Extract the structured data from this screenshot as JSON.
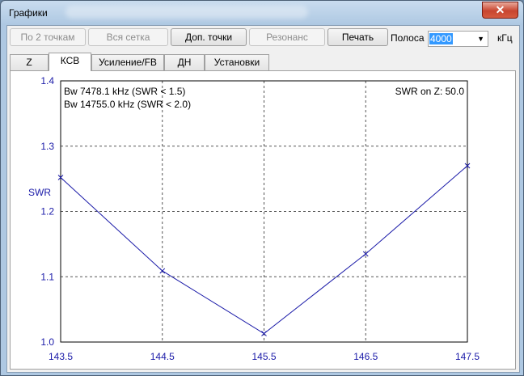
{
  "window": {
    "title": "Графики",
    "close_glyph": "✕"
  },
  "toolbar": {
    "buttons": [
      {
        "label": "По 2 точкам",
        "enabled": false
      },
      {
        "label": "Вся сетка",
        "enabled": false
      },
      {
        "label": "Доп. точки",
        "enabled": true
      },
      {
        "label": "Резонанс",
        "enabled": false
      },
      {
        "label": "Печать",
        "enabled": true
      }
    ],
    "band_label": "Полоса",
    "band_value": "4000",
    "band_unit": "кГц"
  },
  "tabs": [
    {
      "label": "Z",
      "active": false
    },
    {
      "label": "КСВ",
      "active": true
    },
    {
      "label": "Усиление/FB",
      "active": false
    },
    {
      "label": "ДН",
      "active": false
    },
    {
      "label": "Установки",
      "active": false
    }
  ],
  "colors": {
    "plot_blue": "#1a1aa8",
    "grid": "#555555"
  },
  "chart_data": {
    "type": "line",
    "ylabel": "SWR",
    "xlim": [
      143.5,
      147.5
    ],
    "ylim": [
      1.0,
      1.4
    ],
    "x_ticks": [
      "143.5",
      "144.5",
      "145.5",
      "146.5",
      "147.5"
    ],
    "y_ticks": [
      "1.4",
      "1.3",
      "1.2",
      "1.1",
      "1.0"
    ],
    "grid": true,
    "annotations": [
      "Bw 7478.1 kHz (SWR < 1.5)",
      "Bw 14755.0 kHz (SWR < 2.0)",
      "SWR on Z: 50.0"
    ],
    "series": [
      {
        "x": [
          143.5,
          144.5,
          145.5,
          146.5,
          147.5
        ],
        "y": [
          1.252,
          1.109,
          1.013,
          1.135,
          1.27
        ]
      }
    ]
  }
}
